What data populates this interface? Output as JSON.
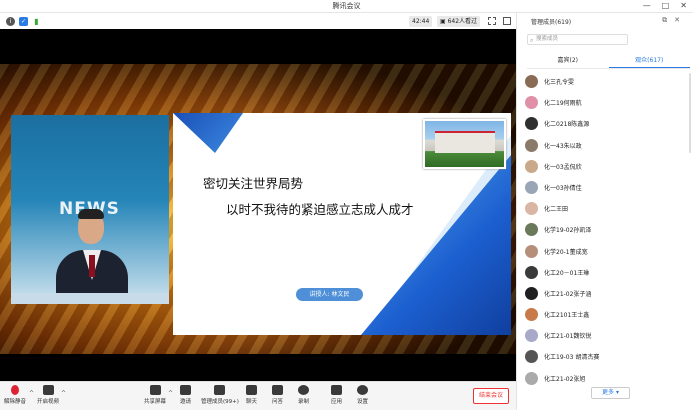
{
  "window": {
    "title": "腾讯会议",
    "controls": [
      "—",
      "□",
      "✕"
    ]
  },
  "infobar": {
    "time": "42:44",
    "viewers": "642人看过"
  },
  "slide": {
    "line1": "密切关注世界局势",
    "line2": "以时不我待的紧迫感立志成人成才",
    "speaker": "讲授人: 林文民"
  },
  "news_text": "NEWS",
  "toolbar": {
    "unmute": "解除静音",
    "video": "开启视频",
    "share": "共享屏幕",
    "invite": "邀请",
    "manage": "管理成员(99+)",
    "chat": "聊天",
    "qa": "问答",
    "record": "录制",
    "apps": "应用",
    "settings": "设置",
    "end": "结束会议"
  },
  "panel": {
    "title": "管理成员(619)",
    "search_placeholder": "搜索成员",
    "tabs": [
      "嘉宾(2)",
      "观众(617)"
    ],
    "members": [
      {
        "name": "化三孔令雯",
        "color": "#8a6b55"
      },
      {
        "name": "化二19何雨航",
        "color": "#e08fa8"
      },
      {
        "name": "化二0218陈鑫源",
        "color": "#2f2f2f"
      },
      {
        "name": "化一43朱以政",
        "color": "#8a7a6a"
      },
      {
        "name": "化一03孟侃欣",
        "color": "#c9a98a"
      },
      {
        "name": "化一03孙倩佳",
        "color": "#9aa5b5"
      },
      {
        "name": "化二王田",
        "color": "#d9b6a3"
      },
      {
        "name": "化学19-02孙凯泽",
        "color": "#6b7a5a"
      },
      {
        "name": "化学20-1董成宽",
        "color": "#b58f7a"
      },
      {
        "name": "化工20－01王琳",
        "color": "#3a3a3a"
      },
      {
        "name": "化工21-02张子涵",
        "color": "#1f1f1f"
      },
      {
        "name": "化工2101王士鑫",
        "color": "#c97a4a"
      },
      {
        "name": "化工21-01魏钦锐",
        "color": "#a8a8c8"
      },
      {
        "name": "化工19-03 胡清杰赛",
        "color": "#555555"
      },
      {
        "name": "化工21-02张旭",
        "color": "#aaaaaa"
      }
    ],
    "more": "更多 ▾"
  }
}
